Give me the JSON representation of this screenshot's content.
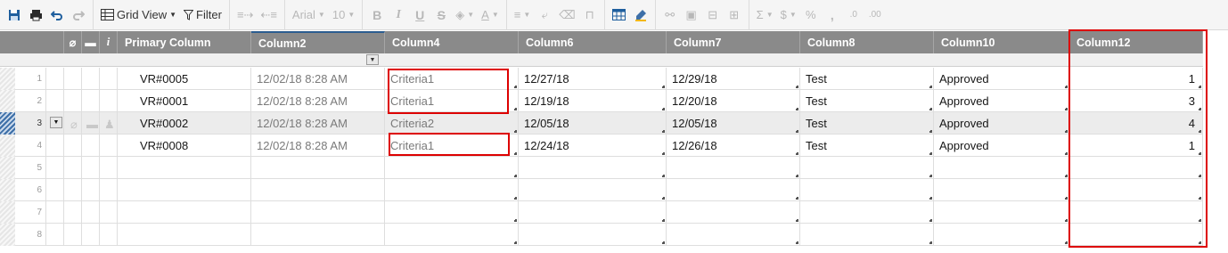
{
  "toolbar": {
    "view_label": "Grid View",
    "filter_label": "Filter",
    "font_name": "Arial",
    "font_size": "10",
    "bold": "B",
    "italic": "I",
    "underline": "U",
    "strike": "S",
    "sum": "Σ",
    "currency": "$",
    "percent": "%",
    "thousands": ",",
    "dec_less": ".0",
    "dec_more": ".00"
  },
  "columns": {
    "primary": "Primary Column",
    "c2": "Column2",
    "c4": "Column4",
    "c6": "Column6",
    "c7": "Column7",
    "c8": "Column8",
    "c10": "Column10",
    "c12": "Column12"
  },
  "rows": [
    {
      "num": "1",
      "primary": "VR#0005",
      "c2": "12/02/18 8:28 AM",
      "c4": "Criteria1",
      "c6": "12/27/18",
      "c7": "12/29/18",
      "c8": "Test",
      "c10": "Approved",
      "c12": "1"
    },
    {
      "num": "2",
      "primary": "VR#0001",
      "c2": "12/02/18 8:28 AM",
      "c4": "Criteria1",
      "c6": "12/19/18",
      "c7": "12/20/18",
      "c8": "Test",
      "c10": "Approved",
      "c12": "3"
    },
    {
      "num": "3",
      "primary": "VR#0002",
      "c2": "12/02/18 8:28 AM",
      "c4": "Criteria2",
      "c6": "12/05/18",
      "c7": "12/05/18",
      "c8": "Test",
      "c10": "Approved",
      "c12": "4"
    },
    {
      "num": "4",
      "primary": "VR#0008",
      "c2": "12/02/18 8:28 AM",
      "c4": "Criteria1",
      "c6": "12/24/18",
      "c7": "12/26/18",
      "c8": "Test",
      "c10": "Approved",
      "c12": "1"
    },
    {
      "num": "5"
    },
    {
      "num": "6"
    },
    {
      "num": "7"
    },
    {
      "num": "8"
    }
  ],
  "colors": {
    "header_bg": "#8a8a8a",
    "highlight": "#dd0000",
    "accent": "#2b5c8f"
  }
}
